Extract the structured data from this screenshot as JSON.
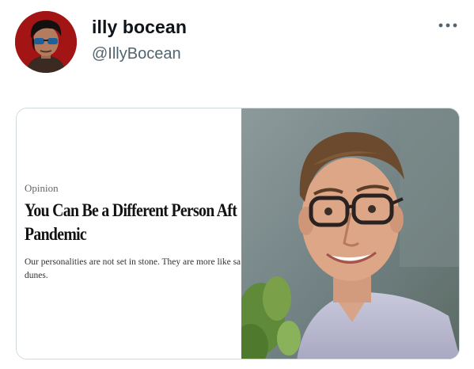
{
  "tweet": {
    "display_name": "illy bocean",
    "handle": "@IllyBocean",
    "more_icon": "more-horizontal-icon"
  },
  "embedded_article": {
    "kicker": "Opinion",
    "headline_lines": [
      "You Can Be a Different Person Aft",
      "Pandemic"
    ],
    "summary_lines": [
      "Our personalities are not set in stone. They are more like sa",
      "dunes."
    ]
  },
  "colors": {
    "avatar_bg": "#a31414",
    "handle_text": "#536471",
    "card_border": "#cfd9de"
  }
}
